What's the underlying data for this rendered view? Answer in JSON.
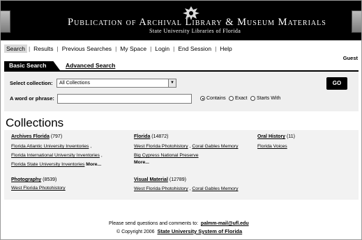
{
  "header": {
    "title": "Publication of Archival Library & Museum Materials",
    "subtitle": "State University Libraries of Florida"
  },
  "nav": {
    "items": [
      "Search",
      "Results",
      "Previous Searches",
      "My Space",
      "Login",
      "End Session",
      "Help"
    ],
    "active": "Search"
  },
  "user": {
    "label": "Guest"
  },
  "tabs": {
    "basic": "Basic Search",
    "advanced": "Advanced Search"
  },
  "search": {
    "collection_label": "Select collection:",
    "collection_value": "All Collections",
    "phrase_label": "A word or phrase:",
    "phrase_value": "",
    "go_label": "GO",
    "match_options": [
      "Contains",
      "Exact",
      "Starts With"
    ],
    "match_selected": "Contains"
  },
  "collections": {
    "title": "Collections",
    "groups": [
      {
        "name": "Archives Florida",
        "count": "(797)",
        "links": [
          "Florida Atlantic University Inventories",
          "Florida International University Inventories",
          "Florida State University Inventories"
        ],
        "more": "More..."
      },
      {
        "name": "Florida",
        "count": "(14872)",
        "links": [
          "West Florida Photohistory",
          "Coral Gables Memory",
          "Big Cypress National Preserve"
        ],
        "more": "More..."
      },
      {
        "name": "Oral History",
        "count": "(11)",
        "links": [
          "Florida Voices"
        ]
      },
      {
        "name": "Photography",
        "count": "(8539)",
        "links": [
          "West Florida Photohistory"
        ]
      },
      {
        "name": "Visual Material",
        "count": "(12789)",
        "links": [
          "West Florida Photohistory",
          "Coral Gables Memory"
        ]
      }
    ]
  },
  "footer": {
    "contact_text": "Please send questions and comments to:",
    "contact_email": "palmm-mail@ufl.edu",
    "copyright": "© Copyright 2006",
    "org": "State University System of Florida"
  }
}
